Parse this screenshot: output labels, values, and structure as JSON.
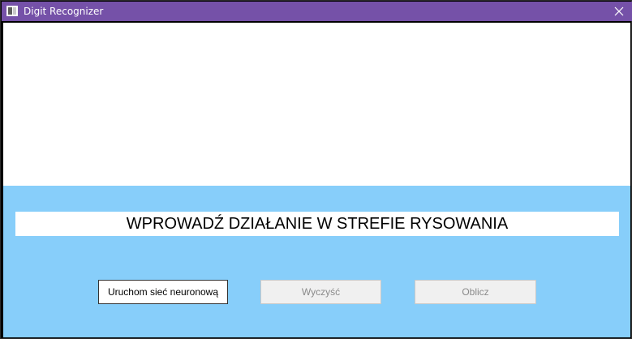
{
  "window": {
    "title": "Digit Recognizer",
    "titlebar_color": "#7551a8"
  },
  "icons": {
    "app": "app-icon",
    "close": "close-icon"
  },
  "draw_area": {
    "background": "#ffffff"
  },
  "panel": {
    "background": "#87cefa",
    "message": "WPROWADŹ DZIAŁANIE W STREFIE RYSOWANIA"
  },
  "buttons": {
    "start_label": "Uruchom sieć neuronową",
    "clear_label": "Wyczyść",
    "calc_label": "Oblicz",
    "clear_enabled": false,
    "calc_enabled": false
  }
}
